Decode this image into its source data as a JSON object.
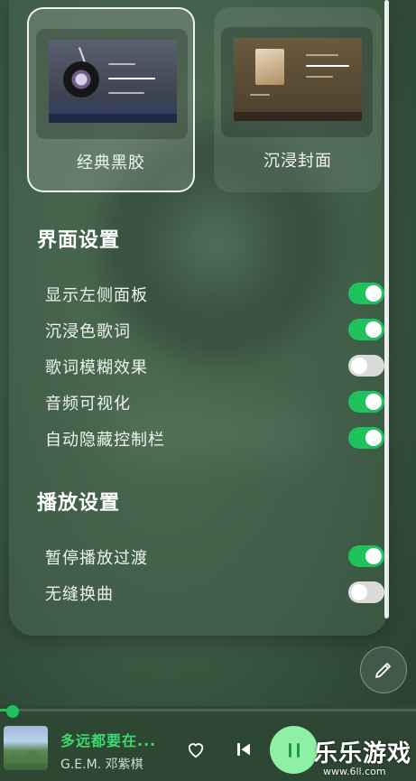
{
  "themes": [
    {
      "label": "经典黑胶",
      "selected": true
    },
    {
      "label": "沉浸封面",
      "selected": false
    }
  ],
  "interface_settings": {
    "title": "界面设置",
    "items": [
      {
        "label": "显示左侧面板",
        "on": true
      },
      {
        "label": "沉浸色歌词",
        "on": true
      },
      {
        "label": "歌词模糊效果",
        "on": false
      },
      {
        "label": "音频可视化",
        "on": true
      },
      {
        "label": "自动隐藏控制栏",
        "on": true
      }
    ]
  },
  "playback_settings": {
    "title": "播放设置",
    "items": [
      {
        "label": "暂停播放过渡",
        "on": true
      },
      {
        "label": "无缝换曲",
        "on": false
      }
    ]
  },
  "player": {
    "title": "多远都要在...",
    "artist": "G.E.M. 邓紫棋",
    "progress": 0.03
  },
  "icons": {
    "fab": "pencil-icon",
    "favorite": "heart-icon",
    "previous": "skip-previous-icon",
    "play_pause": "pause-icon"
  },
  "colors": {
    "accent": "#1fc25d",
    "accent_light": "#8ef0a4",
    "song_title": "#3ddb6f"
  },
  "watermark": {
    "main": "乐乐游戏",
    "sub": "www.6ll.com"
  }
}
